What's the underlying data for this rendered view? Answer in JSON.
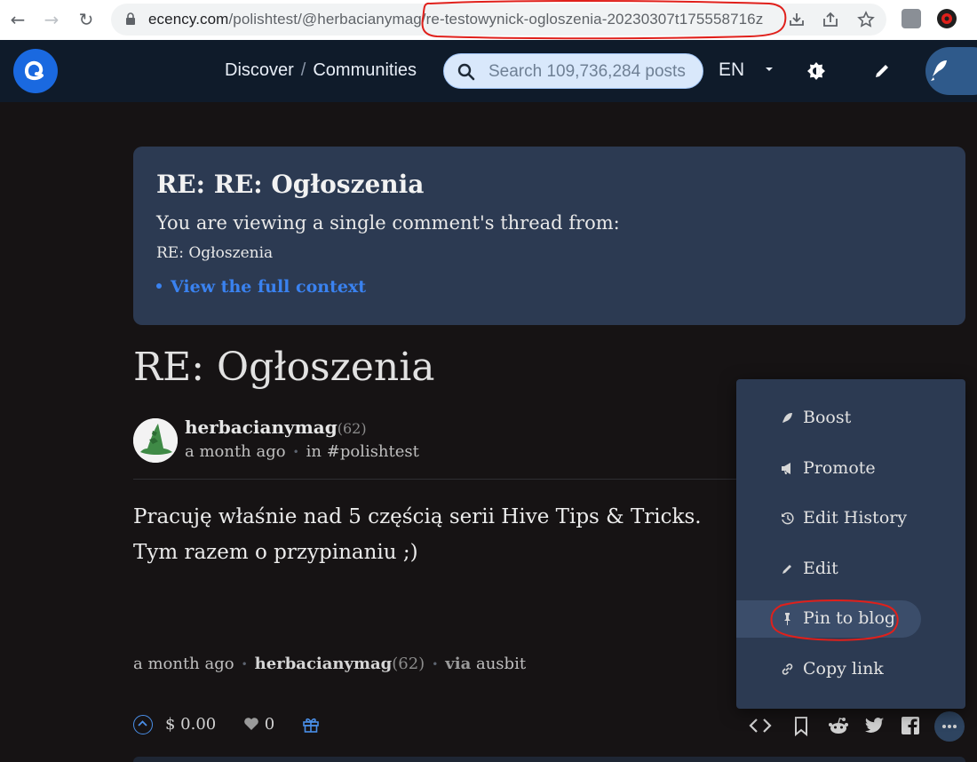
{
  "browser": {
    "url_host": "ecency.com",
    "url_path": "/polishtest/@herbacianymag/re-testowynick-ogloszenia-20230307t175558716z"
  },
  "header": {
    "breadcrumb_discover": "Discover",
    "breadcrumb_separator": "/",
    "breadcrumb_communities": "Communities",
    "search_placeholder": "Search 109,736,284 posts",
    "language": "EN"
  },
  "thread": {
    "title": "RE: RE: Ogłoszenia",
    "notice": "You are viewing a single comment's thread from:",
    "parent_title": "RE: Ogłoszenia",
    "context_link": "View the full context"
  },
  "post": {
    "title": "RE: Ogłoszenia",
    "author": "herbacianymag",
    "reputation": "(62)",
    "time": "a month ago",
    "community": "in #polishtest",
    "body": "Pracuję właśnie nad 5 częścią serii Hive Tips & Tricks. Tym razem o przypinaniu ;)",
    "footer_time": "a month ago",
    "footer_author": "herbacianymag",
    "footer_reputation": "(62)",
    "via_label": "via",
    "app": "ausbit",
    "payout": "$ 0.00",
    "likes": "0"
  },
  "menu": {
    "items": [
      {
        "label": "Boost",
        "icon": "rocket-icon"
      },
      {
        "label": "Promote",
        "icon": "megaphone-icon"
      },
      {
        "label": "Edit History",
        "icon": "history-icon"
      },
      {
        "label": "Edit",
        "icon": "pencil-icon"
      },
      {
        "label": "Pin to blog",
        "icon": "pin-icon"
      },
      {
        "label": "Copy link",
        "icon": "link-icon"
      }
    ],
    "active_index": 4
  },
  "colors": {
    "page_bg": "#161314",
    "header_bg": "#0f1b2a",
    "card_bg": "#2c3a52",
    "link": "#3a82f0",
    "annotation_red": "#e0201b"
  }
}
